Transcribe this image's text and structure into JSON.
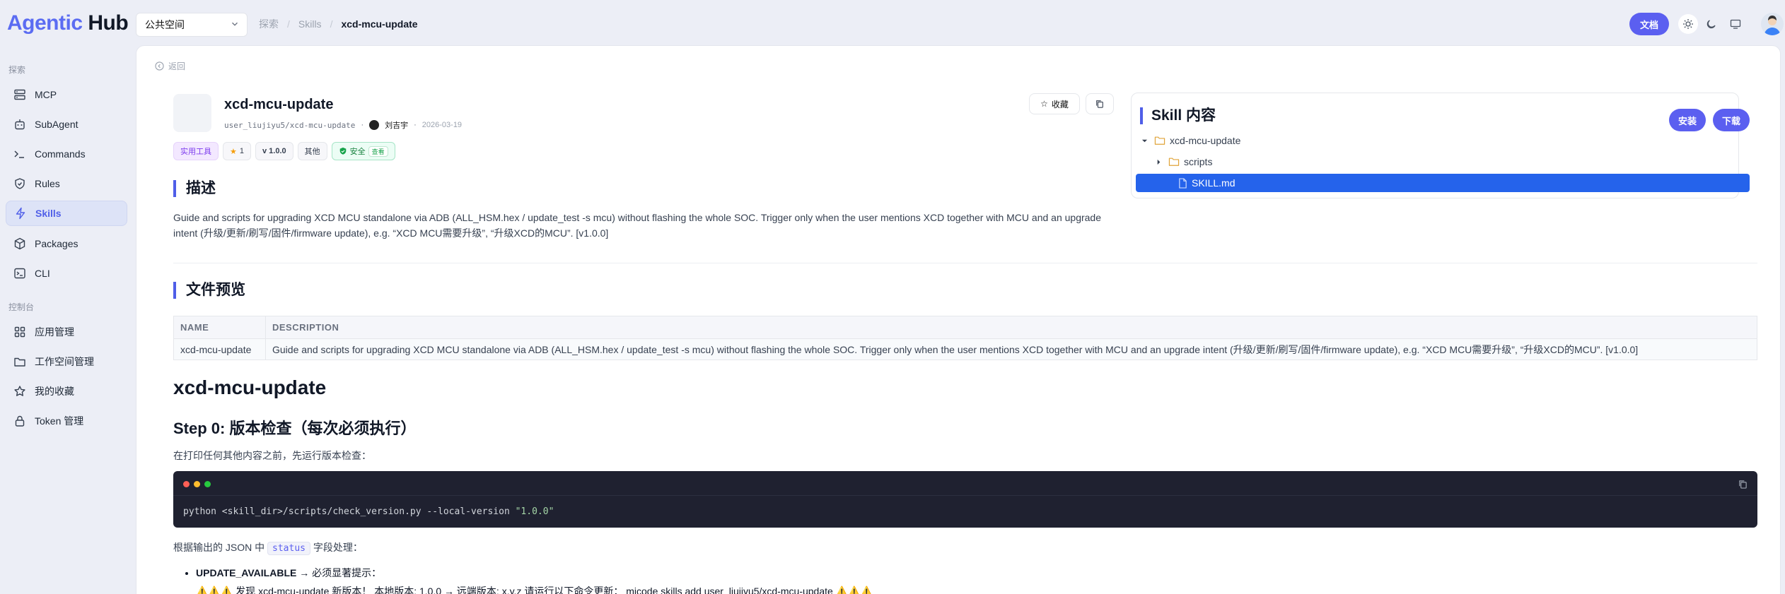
{
  "header": {
    "logo_part1": "Agentic",
    "logo_part2": "Hub",
    "space_select": "公共空间",
    "breadcrumb": [
      "探索",
      "Skills",
      "xcd-mcu-update"
    ],
    "docs_button": "文档"
  },
  "sidebar": {
    "group_explore": "探索",
    "group_console": "控制台",
    "items": [
      {
        "label": "MCP",
        "icon": "server-icon"
      },
      {
        "label": "SubAgent",
        "icon": "robot-icon"
      },
      {
        "label": "Commands",
        "icon": "terminal-prompt-icon"
      },
      {
        "label": "Rules",
        "icon": "shield-icon"
      },
      {
        "label": "Skills",
        "icon": "lightning-icon",
        "active": true
      },
      {
        "label": "Packages",
        "icon": "package-icon"
      },
      {
        "label": "CLI",
        "icon": "terminal-box-icon"
      }
    ],
    "console_items": [
      {
        "label": "应用管理",
        "icon": "grid-icon"
      },
      {
        "label": "工作空间管理",
        "icon": "folder-icon"
      },
      {
        "label": "我的收藏",
        "icon": "star-icon"
      },
      {
        "label": "Token 管理",
        "icon": "lock-icon"
      }
    ]
  },
  "skill": {
    "back": "返回",
    "name": "xcd-mcu-update",
    "path": "user_liujiyu5/xcd-mcu-update",
    "author": "刘吉宇",
    "date": "2026-03-19",
    "tags": {
      "category": "实用工具",
      "stars": "1",
      "version": "v 1.0.0",
      "other": "其他",
      "security": "安全",
      "security_link": "查看"
    },
    "favorite": "收藏",
    "desc_title": "描述",
    "description": "Guide and scripts for upgrading XCD MCU standalone via ADB (ALL_HSM.hex / update_test -s mcu) without flashing the whole SOC. Trigger only when the user mentions XCD together with MCU and an upgrade intent (升级/更新/刷写/固件/firmware update), e.g. “XCD MCU需要升级”, “升级XCD的MCU”. [v1.0.0]"
  },
  "tree": {
    "title": "Skill 内容",
    "install": "安装",
    "download": "下载",
    "root": "xcd-mcu-update",
    "folder": "scripts",
    "file": "SKILL.md"
  },
  "preview": {
    "title": "文件预览",
    "columns": [
      "NAME",
      "DESCRIPTION"
    ],
    "row": {
      "name": "xcd-mcu-update",
      "description": "Guide and scripts for upgrading XCD MCU standalone via ADB (ALL_HSM.hex / update_test -s mcu) without flashing the whole SOC. Trigger only when the user mentions XCD together with MCU and an upgrade intent (升级/更新/刷写/固件/firmware update), e.g. “XCD MCU需要升级”, “升级XCD的MCU”. [v1.0.0]"
    }
  },
  "markdown": {
    "h1": "xcd-mcu-update",
    "h2": "Step 0: 版本检查（每次必须执行）",
    "p1": "在打印任何其他内容之前，先运行版本检查：",
    "code_cmd": "python <skill_dir>/scripts/check_version.py --local-version ",
    "code_str": "\"1.0.0\"",
    "p2_before": "根据输出的 JSON 中",
    "p2_code": "status",
    "p2_after": "字段处理：",
    "li_strong": "UPDATE_AVAILABLE",
    "li_rest": " → 必须显著提示：",
    "li_sub": "⚠️⚠️⚠️ 发现 xcd-mcu-update 新版本！ 本地版本: 1.0.0 → 远端版本: x.y.z 请运行以下命令更新： micode skills add user_liujiyu5/xcd-mcu-update ⚠️⚠️⚠️"
  },
  "colors": {
    "accent": "#5b5ff0",
    "selected": "#2563eb",
    "code_bg": "#1f2130"
  }
}
